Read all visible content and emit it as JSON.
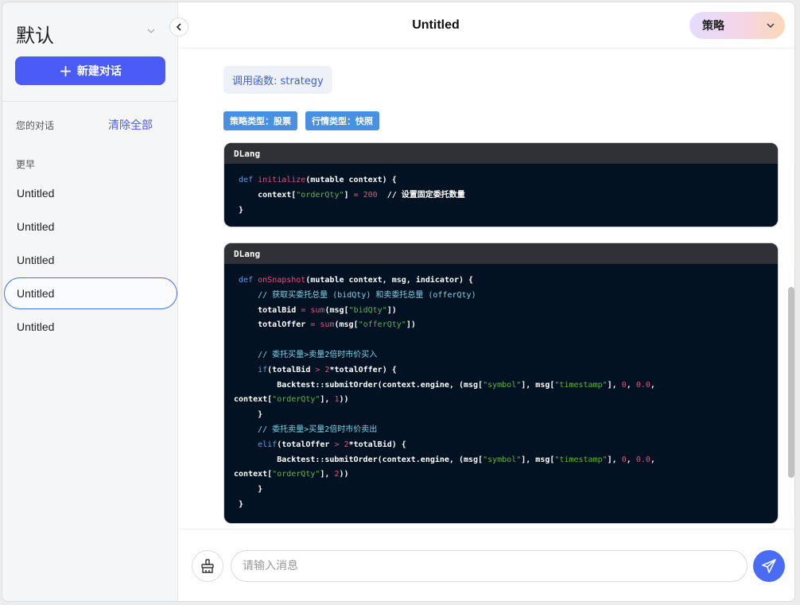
{
  "sidebar": {
    "workspace_title": "默认",
    "new_chat_label": "新建对话",
    "your_conversations": "您的对话",
    "clear_all": "清除全部",
    "group_earlier": "更早",
    "conversations": [
      "Untitled",
      "Untitled",
      "Untitled",
      "Untitled",
      "Untitled"
    ],
    "active_index": 3
  },
  "header": {
    "title": "Untitled",
    "mode": "策略"
  },
  "message": {
    "function_call": "调用函数: strategy",
    "tags": [
      "策略类型：股票",
      "行情类型：快照"
    ],
    "code_blocks": [
      {
        "lang": "DLang"
      },
      {
        "lang": "DLang"
      }
    ]
  },
  "input": {
    "placeholder": "请输入消息"
  },
  "colors": {
    "accent": "#4a5cf5",
    "tag": "#4a90e2",
    "code_bg": "#031222"
  },
  "icons": [
    "chevron-down-icon",
    "chevron-left-icon",
    "plus-icon",
    "broom-icon",
    "send-icon"
  ]
}
